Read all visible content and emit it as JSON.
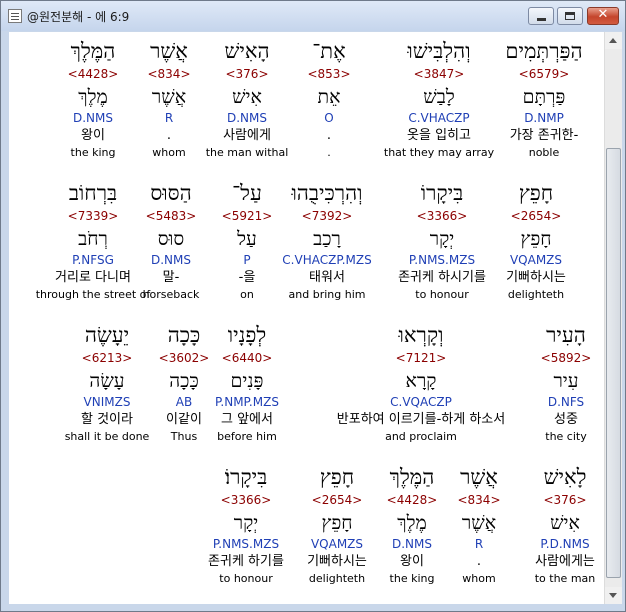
{
  "window": {
    "title": "@원전분해 - 에 6:9"
  },
  "controls": {
    "minimize": "",
    "maximize": "",
    "close": "✕"
  },
  "rows": [
    {
      "words": [
        {
          "heb": "הַפַּרְתְּמִים",
          "strong": "<6579>",
          "lemma": "פַּרְתָּם",
          "morph": "D.NMP",
          "kor": "가장 존귀한-",
          "eng": "noble"
        },
        {
          "heb": "וְהִלְבִּישׁוּ",
          "strong": "<3847>",
          "lemma": "לָבַשׁ",
          "morph": "C.VHACZP",
          "kor": "옷을 입히고",
          "eng": "that they may array"
        },
        {
          "heb": "אֶת־",
          "strong": "<853>",
          "lemma": "אֵת",
          "morph": "O",
          "kor": ".",
          "eng": "."
        },
        {
          "heb": "הָאִישׁ",
          "strong": "<376>",
          "lemma": "אִישׁ",
          "morph": "D.NMS",
          "kor": "사람에게",
          "eng": "the man withal"
        },
        {
          "heb": "אֲשֶׁר",
          "strong": "<834>",
          "lemma": "אֲשֶׁר",
          "morph": "R",
          "kor": ".",
          "eng": "whom"
        },
        {
          "heb": "הַמֶּלֶךְ",
          "strong": "<4428>",
          "lemma": "מֶלֶךְ",
          "morph": "D.NMS",
          "kor": "왕이",
          "eng": "the king"
        }
      ]
    },
    {
      "words": [
        {
          "heb": "חָפֵץ",
          "strong": "<2654>",
          "lemma": "חָפֵץ",
          "morph": "VQAMZS",
          "kor": "기뻐하시는",
          "eng": "delighteth"
        },
        {
          "heb": "בִּיקָרוֹ",
          "strong": "<3366>",
          "lemma": "יְקָר",
          "morph": "P.NMS.MZS",
          "kor": "존귀케 하시기를",
          "eng": "to honour"
        },
        {
          "heb": "וְהִרְכִּיבֻהוּ",
          "strong": "<7392>",
          "lemma": "רָכַב",
          "morph": "C.VHACZP.MZS",
          "kor": "태워서",
          "eng": "and bring him"
        },
        {
          "heb": "עַל־",
          "strong": "<5921>",
          "lemma": "עַל",
          "morph": "P",
          "kor": "-을",
          "eng": "on"
        },
        {
          "heb": "הַסּוּס",
          "strong": "<5483>",
          "lemma": "סוּס",
          "morph": "D.NMS",
          "kor": "말-",
          "eng": "horseback"
        },
        {
          "heb": "בִּרְחוֹב",
          "strong": "<7339>",
          "lemma": "רְחֹב",
          "morph": "P.NFSG",
          "kor": "거리로 다니며",
          "eng": "through the street of"
        }
      ]
    },
    {
      "words": [
        {
          "heb": "הָעִיר",
          "strong": "<5892>",
          "lemma": "עִיר",
          "morph": "D.NFS",
          "kor": "성중",
          "eng": "the city"
        },
        {
          "heb": "וְקָרְאוּ",
          "strong": "<7121>",
          "lemma": "קָרָא",
          "morph": "C.VQACZP",
          "kor": "반포하여 이르기를-하게 하소서",
          "eng": "and proclaim"
        },
        {
          "heb": "לְפָנָיו",
          "strong": "<6440>",
          "lemma": "פָּנִים",
          "morph": "P.NMP.MZS",
          "kor": "그 앞에서",
          "eng": "before him"
        },
        {
          "heb": "כָּכָה",
          "strong": "<3602>",
          "lemma": "כָּכָה",
          "morph": "AB",
          "kor": "이같이",
          "eng": "Thus"
        },
        {
          "heb": "יֵעָשֶׂה",
          "strong": "<6213>",
          "lemma": "עָשָׂה",
          "morph": "VNIMZS",
          "kor": "할 것이라",
          "eng": "shall it be done"
        }
      ]
    },
    {
      "words": [
        {
          "heb": "לָאִישׁ",
          "strong": "<376>",
          "lemma": "אִישׁ",
          "morph": "P.D.NMS",
          "kor": "사람에게는",
          "eng": "to the man"
        },
        {
          "heb": "אֲשֶׁר",
          "strong": "<834>",
          "lemma": "אֲשֶׁר",
          "morph": "R",
          "kor": ".",
          "eng": "whom"
        },
        {
          "heb": "הַמֶּלֶךְ",
          "strong": "<4428>",
          "lemma": "מֶלֶךְ",
          "morph": "D.NMS",
          "kor": "왕이",
          "eng": "the king"
        },
        {
          "heb": "חָפֵץ",
          "strong": "<2654>",
          "lemma": "חָפֵץ",
          "morph": "VQAMZS",
          "kor": "기뻐하시는",
          "eng": "delighteth"
        },
        {
          "heb": "בִּיקָרוֹ׃",
          "strong": "<3366>",
          "lemma": "יְקָר",
          "morph": "P.NMS.MZS",
          "kor": "존귀케 하기를",
          "eng": "to honour"
        }
      ]
    }
  ]
}
